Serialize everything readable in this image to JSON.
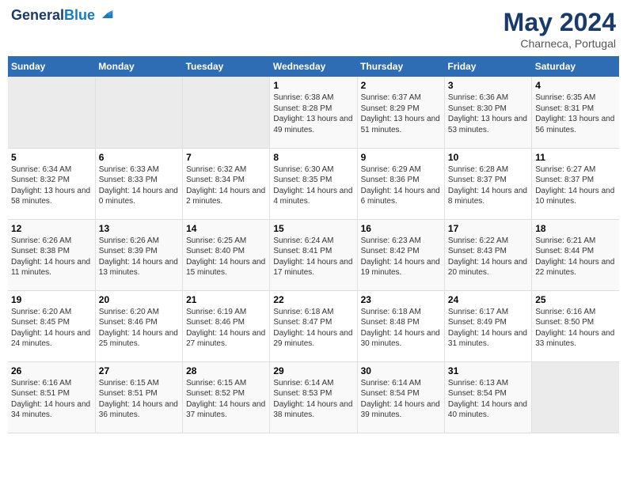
{
  "header": {
    "logo_line1": "General",
    "logo_line2": "Blue",
    "month": "May 2024",
    "location": "Charneca, Portugal"
  },
  "days_of_week": [
    "Sunday",
    "Monday",
    "Tuesday",
    "Wednesday",
    "Thursday",
    "Friday",
    "Saturday"
  ],
  "weeks": [
    [
      {
        "day": "",
        "sunrise": "",
        "sunset": "",
        "daylight": ""
      },
      {
        "day": "",
        "sunrise": "",
        "sunset": "",
        "daylight": ""
      },
      {
        "day": "",
        "sunrise": "",
        "sunset": "",
        "daylight": ""
      },
      {
        "day": "1",
        "sunrise": "Sunrise: 6:38 AM",
        "sunset": "Sunset: 8:28 PM",
        "daylight": "Daylight: 13 hours and 49 minutes."
      },
      {
        "day": "2",
        "sunrise": "Sunrise: 6:37 AM",
        "sunset": "Sunset: 8:29 PM",
        "daylight": "Daylight: 13 hours and 51 minutes."
      },
      {
        "day": "3",
        "sunrise": "Sunrise: 6:36 AM",
        "sunset": "Sunset: 8:30 PM",
        "daylight": "Daylight: 13 hours and 53 minutes."
      },
      {
        "day": "4",
        "sunrise": "Sunrise: 6:35 AM",
        "sunset": "Sunset: 8:31 PM",
        "daylight": "Daylight: 13 hours and 56 minutes."
      }
    ],
    [
      {
        "day": "5",
        "sunrise": "Sunrise: 6:34 AM",
        "sunset": "Sunset: 8:32 PM",
        "daylight": "Daylight: 13 hours and 58 minutes."
      },
      {
        "day": "6",
        "sunrise": "Sunrise: 6:33 AM",
        "sunset": "Sunset: 8:33 PM",
        "daylight": "Daylight: 14 hours and 0 minutes."
      },
      {
        "day": "7",
        "sunrise": "Sunrise: 6:32 AM",
        "sunset": "Sunset: 8:34 PM",
        "daylight": "Daylight: 14 hours and 2 minutes."
      },
      {
        "day": "8",
        "sunrise": "Sunrise: 6:30 AM",
        "sunset": "Sunset: 8:35 PM",
        "daylight": "Daylight: 14 hours and 4 minutes."
      },
      {
        "day": "9",
        "sunrise": "Sunrise: 6:29 AM",
        "sunset": "Sunset: 8:36 PM",
        "daylight": "Daylight: 14 hours and 6 minutes."
      },
      {
        "day": "10",
        "sunrise": "Sunrise: 6:28 AM",
        "sunset": "Sunset: 8:37 PM",
        "daylight": "Daylight: 14 hours and 8 minutes."
      },
      {
        "day": "11",
        "sunrise": "Sunrise: 6:27 AM",
        "sunset": "Sunset: 8:37 PM",
        "daylight": "Daylight: 14 hours and 10 minutes."
      }
    ],
    [
      {
        "day": "12",
        "sunrise": "Sunrise: 6:26 AM",
        "sunset": "Sunset: 8:38 PM",
        "daylight": "Daylight: 14 hours and 11 minutes."
      },
      {
        "day": "13",
        "sunrise": "Sunrise: 6:26 AM",
        "sunset": "Sunset: 8:39 PM",
        "daylight": "Daylight: 14 hours and 13 minutes."
      },
      {
        "day": "14",
        "sunrise": "Sunrise: 6:25 AM",
        "sunset": "Sunset: 8:40 PM",
        "daylight": "Daylight: 14 hours and 15 minutes."
      },
      {
        "day": "15",
        "sunrise": "Sunrise: 6:24 AM",
        "sunset": "Sunset: 8:41 PM",
        "daylight": "Daylight: 14 hours and 17 minutes."
      },
      {
        "day": "16",
        "sunrise": "Sunrise: 6:23 AM",
        "sunset": "Sunset: 8:42 PM",
        "daylight": "Daylight: 14 hours and 19 minutes."
      },
      {
        "day": "17",
        "sunrise": "Sunrise: 6:22 AM",
        "sunset": "Sunset: 8:43 PM",
        "daylight": "Daylight: 14 hours and 20 minutes."
      },
      {
        "day": "18",
        "sunrise": "Sunrise: 6:21 AM",
        "sunset": "Sunset: 8:44 PM",
        "daylight": "Daylight: 14 hours and 22 minutes."
      }
    ],
    [
      {
        "day": "19",
        "sunrise": "Sunrise: 6:20 AM",
        "sunset": "Sunset: 8:45 PM",
        "daylight": "Daylight: 14 hours and 24 minutes."
      },
      {
        "day": "20",
        "sunrise": "Sunrise: 6:20 AM",
        "sunset": "Sunset: 8:46 PM",
        "daylight": "Daylight: 14 hours and 25 minutes."
      },
      {
        "day": "21",
        "sunrise": "Sunrise: 6:19 AM",
        "sunset": "Sunset: 8:46 PM",
        "daylight": "Daylight: 14 hours and 27 minutes."
      },
      {
        "day": "22",
        "sunrise": "Sunrise: 6:18 AM",
        "sunset": "Sunset: 8:47 PM",
        "daylight": "Daylight: 14 hours and 29 minutes."
      },
      {
        "day": "23",
        "sunrise": "Sunrise: 6:18 AM",
        "sunset": "Sunset: 8:48 PM",
        "daylight": "Daylight: 14 hours and 30 minutes."
      },
      {
        "day": "24",
        "sunrise": "Sunrise: 6:17 AM",
        "sunset": "Sunset: 8:49 PM",
        "daylight": "Daylight: 14 hours and 31 minutes."
      },
      {
        "day": "25",
        "sunrise": "Sunrise: 6:16 AM",
        "sunset": "Sunset: 8:50 PM",
        "daylight": "Daylight: 14 hours and 33 minutes."
      }
    ],
    [
      {
        "day": "26",
        "sunrise": "Sunrise: 6:16 AM",
        "sunset": "Sunset: 8:51 PM",
        "daylight": "Daylight: 14 hours and 34 minutes."
      },
      {
        "day": "27",
        "sunrise": "Sunrise: 6:15 AM",
        "sunset": "Sunset: 8:51 PM",
        "daylight": "Daylight: 14 hours and 36 minutes."
      },
      {
        "day": "28",
        "sunrise": "Sunrise: 6:15 AM",
        "sunset": "Sunset: 8:52 PM",
        "daylight": "Daylight: 14 hours and 37 minutes."
      },
      {
        "day": "29",
        "sunrise": "Sunrise: 6:14 AM",
        "sunset": "Sunset: 8:53 PM",
        "daylight": "Daylight: 14 hours and 38 minutes."
      },
      {
        "day": "30",
        "sunrise": "Sunrise: 6:14 AM",
        "sunset": "Sunset: 8:54 PM",
        "daylight": "Daylight: 14 hours and 39 minutes."
      },
      {
        "day": "31",
        "sunrise": "Sunrise: 6:13 AM",
        "sunset": "Sunset: 8:54 PM",
        "daylight": "Daylight: 14 hours and 40 minutes."
      },
      {
        "day": "",
        "sunrise": "",
        "sunset": "",
        "daylight": ""
      }
    ]
  ]
}
